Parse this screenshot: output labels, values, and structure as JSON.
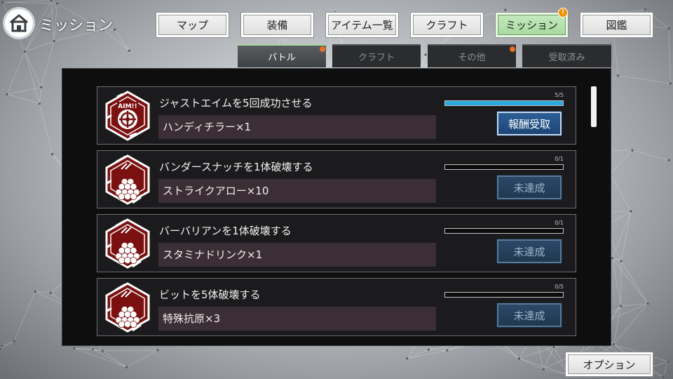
{
  "header": {
    "title": "ミッション",
    "home_icon": "home-icon"
  },
  "nav": {
    "tabs": [
      {
        "label": "マップ"
      },
      {
        "label": "装備"
      },
      {
        "label": "アイテム一覧"
      },
      {
        "label": "クラフト"
      },
      {
        "label": "ミッション",
        "active": true,
        "badge": "!"
      },
      {
        "label": "図鑑"
      }
    ]
  },
  "sub_tabs": [
    {
      "label": "バトル",
      "active": true,
      "dot": true
    },
    {
      "label": "クラフト"
    },
    {
      "label": "その他",
      "dot": true
    },
    {
      "label": "受取済み"
    }
  ],
  "missions": [
    {
      "title": "ジャストエイムを5回成功させる",
      "reward": "ハンディチラー×1",
      "progress_text": "5/5",
      "progress": 1.0,
      "button": "報酬受取",
      "status": "claimable",
      "icon": "aim-badge-icon",
      "icon_text": "AIM!!"
    },
    {
      "title": "バンダースナッチを1体破壊する",
      "reward": "ストライクアロー×10",
      "progress_text": "0/1",
      "progress": 0.0,
      "button": "未達成",
      "status": "incomplete",
      "icon": "destroy-badge-icon"
    },
    {
      "title": "バーバリアンを1体破壊する",
      "reward": "スタミナドリンク×1",
      "progress_text": "0/1",
      "progress": 0.0,
      "button": "未達成",
      "status": "incomplete",
      "icon": "destroy-badge-icon"
    },
    {
      "title": "ビットを5体破壊する",
      "reward": "特殊抗原×3",
      "progress_text": "0/5",
      "progress": 0.0,
      "button": "未達成",
      "status": "incomplete",
      "icon": "destroy-badge-icon"
    }
  ],
  "footer": {
    "option_label": "オプション"
  },
  "colors": {
    "accent_green": "#a6d79c",
    "progress_blue": "#29a9e0",
    "badge_orange": "#f09000",
    "claim_button": "#2c5f95"
  }
}
